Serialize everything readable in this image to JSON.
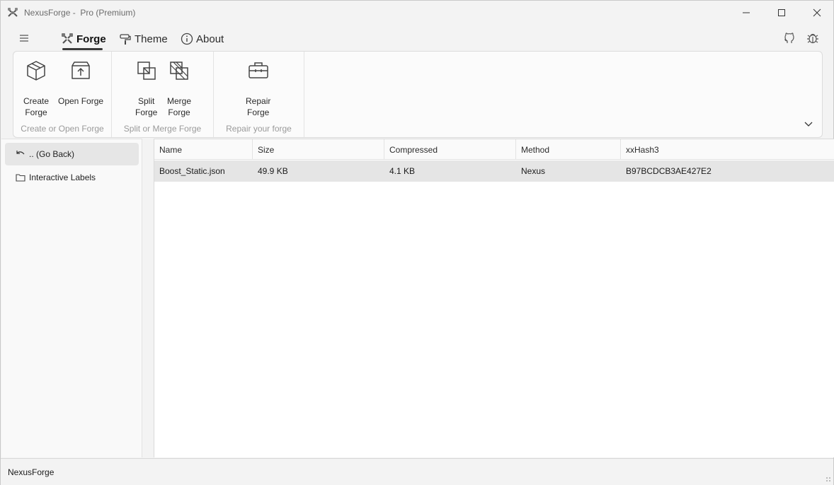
{
  "window": {
    "app_name": "NexusForge",
    "title_suffix": " -  Pro (Premium)"
  },
  "menu": {
    "tabs": [
      {
        "label": "Forge",
        "icon": "forge-icon",
        "active": true
      },
      {
        "label": "Theme",
        "icon": "paint-roller-icon"
      },
      {
        "label": "About",
        "icon": "info-icon"
      }
    ]
  },
  "ribbon": {
    "groups": [
      {
        "label": "Create or Open Forge",
        "buttons": [
          {
            "line1": "Create",
            "line2": "Forge",
            "icon": "box-icon"
          },
          {
            "line1": "Open Forge",
            "line2": "",
            "icon": "upload-box-icon"
          }
        ]
      },
      {
        "label": "Split or Merge Forge",
        "buttons": [
          {
            "line1": "Split",
            "line2": "Forge",
            "icon": "split-icon"
          },
          {
            "line1": "Merge",
            "line2": "Forge",
            "icon": "merge-icon"
          }
        ]
      },
      {
        "label": "Repair your forge",
        "buttons": [
          {
            "line1": "Repair",
            "line2": "Forge",
            "icon": "toolbox-icon"
          }
        ]
      }
    ]
  },
  "nav": {
    "items": [
      {
        "label": ".. (Go Back)",
        "icon": "undo-icon",
        "selected": true
      },
      {
        "label": "Interactive Labels",
        "icon": "folder-icon"
      }
    ]
  },
  "grid": {
    "columns": [
      "Name",
      "Size",
      "Compressed",
      "Method",
      "xxHash3"
    ],
    "rows": [
      {
        "name": "Boost_Static.json",
        "size": "49.9 KB",
        "compressed": "4.1 KB",
        "method": "Nexus",
        "hash": "B97BCDCB3AE427E2"
      }
    ]
  },
  "status": {
    "text": "NexusForge"
  },
  "colors": {
    "background": "#f3f3f3",
    "ribbon": "#fbfbfb",
    "selected_row": "#e5e5e5",
    "group_label": "#9a9a9a"
  }
}
